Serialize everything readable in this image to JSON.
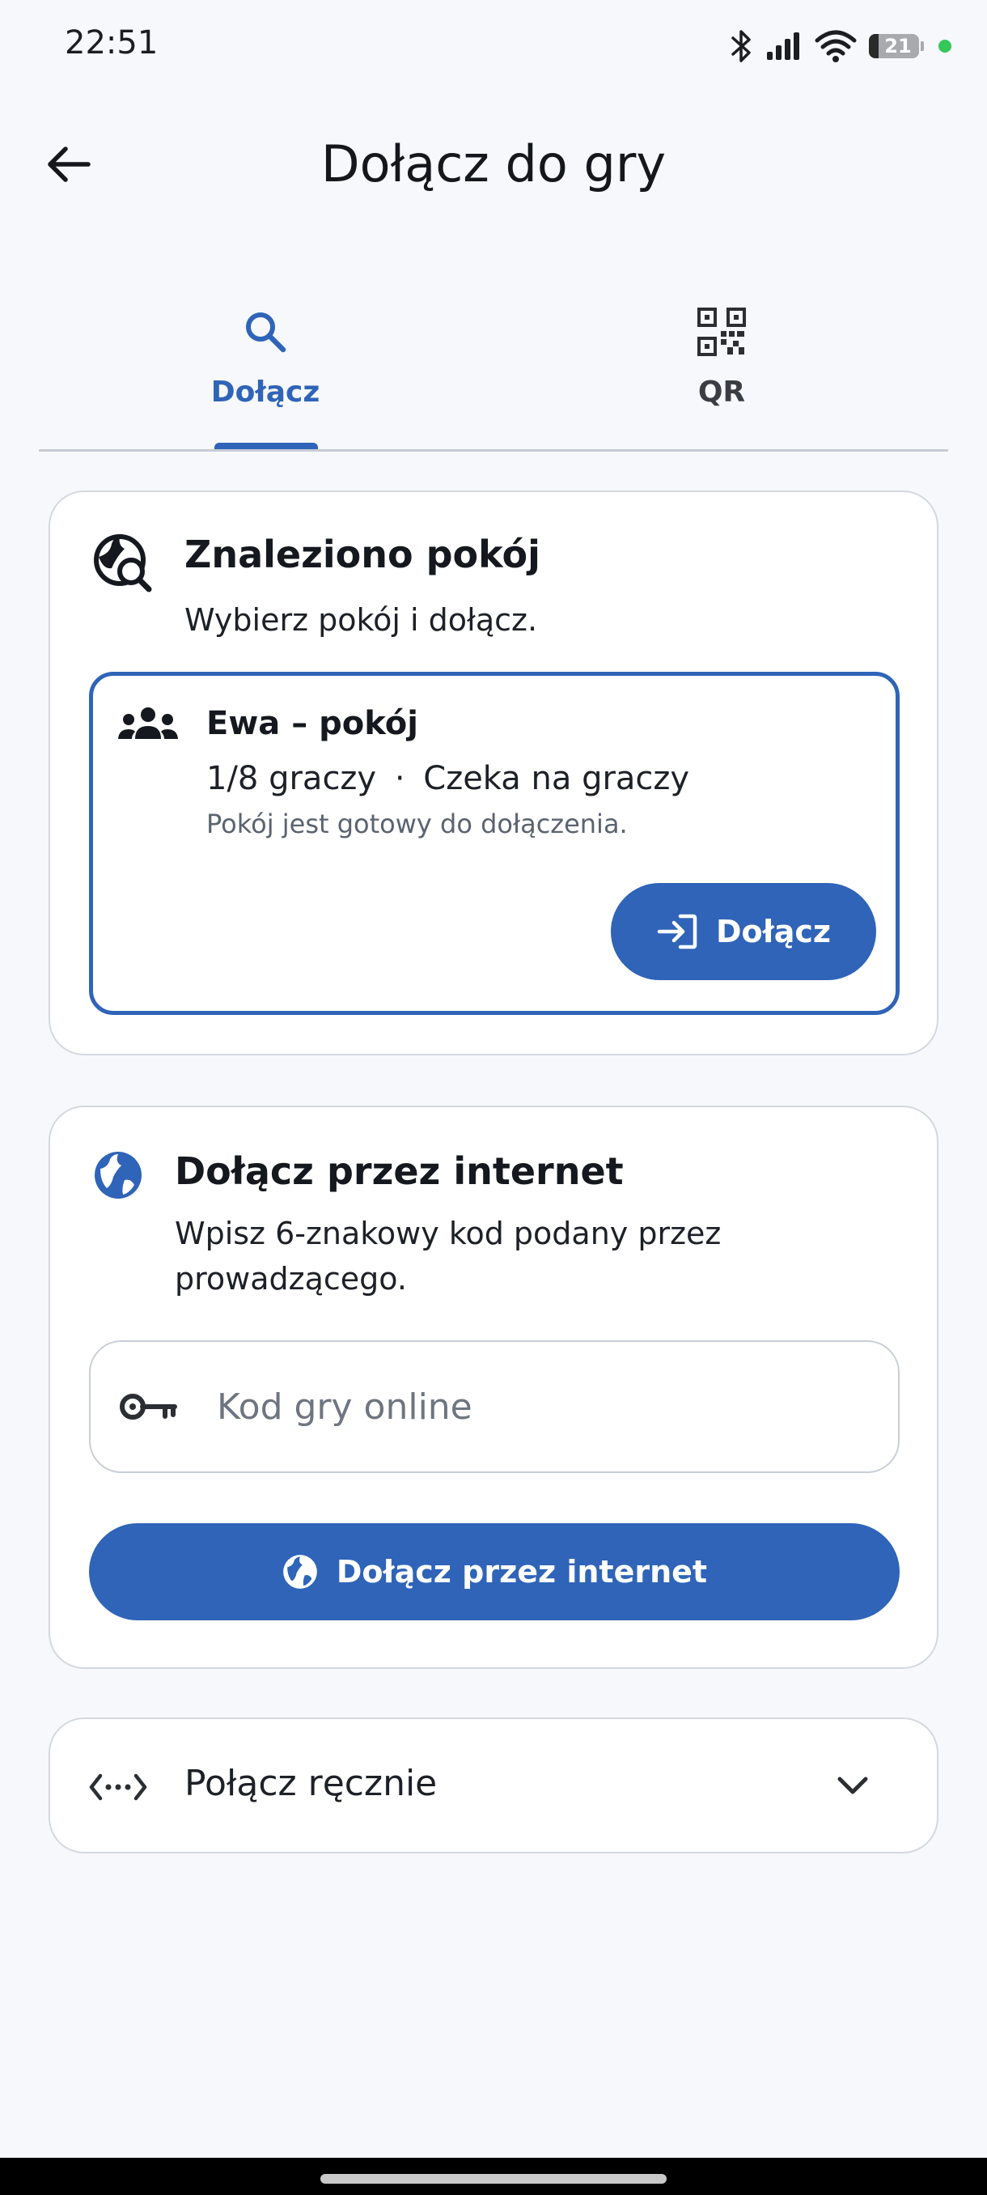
{
  "status_bar": {
    "time": "22:51",
    "battery": "21",
    "icons": [
      "bluetooth-icon",
      "signal-icon",
      "wifi-icon",
      "battery-icon"
    ]
  },
  "app_bar": {
    "title": "Dołącz do gry",
    "back_icon": "arrow-left-icon"
  },
  "tabs": [
    {
      "label": "Dołącz",
      "icon": "search-icon",
      "selected": true
    },
    {
      "label": "QR",
      "icon": "qr-code-icon",
      "selected": false
    }
  ],
  "found_room": {
    "title": "Znaleziono pokój",
    "subtitle": "Wybierz pokój i dołącz.",
    "room": {
      "name": "Ewa – pokój",
      "players": "1/8 graczy",
      "separator": "·",
      "status": "Czeka na graczy",
      "ready_text": "Pokój jest gotowy do dołączenia.",
      "join_label": "Dołącz"
    }
  },
  "online": {
    "title": "Dołącz przez internet",
    "subtitle_line1": "Wpisz 6-znakowy kod podany przez",
    "subtitle_line2": "prowadzącego.",
    "input_placeholder": "Kod gry online",
    "button_label": "Dołącz przez internet"
  },
  "manual": {
    "label": "Połącz ręcznie"
  },
  "colors": {
    "accent": "#2f64b8",
    "background": "#f6f8fb",
    "card": "#ffffff"
  }
}
